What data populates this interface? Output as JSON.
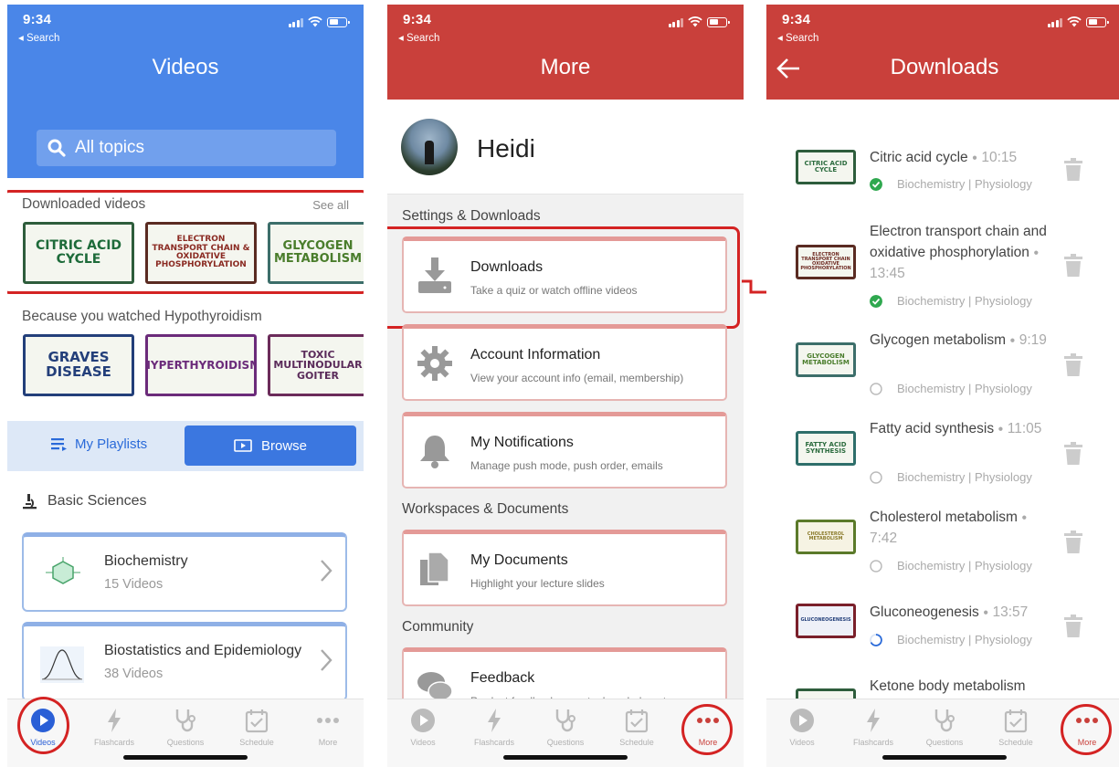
{
  "status": {
    "time": "9:34",
    "back_label": "◂ Search"
  },
  "tabs": [
    "Videos",
    "Flashcards",
    "Questions",
    "Schedule",
    "More"
  ],
  "videos_screen": {
    "title": "Videos",
    "search_placeholder": "All topics",
    "downloaded_heading": "Downloaded videos",
    "see_all": "See all",
    "downloaded_thumbs": [
      {
        "label": "CITRIC ACID CYCLE"
      },
      {
        "label": "ELECTRON TRANSPORT CHAIN & OXIDATIVE PHOSPHORYLATION"
      },
      {
        "label": "GLYCOGEN METABOLISM"
      }
    ],
    "because_heading": "Because you watched Hypothyroidism",
    "because_thumbs": [
      {
        "label": "GRAVES DISEASE"
      },
      {
        "label": "HYPERTHYROIDISM"
      },
      {
        "label": "TOXIC MULTINODULAR GOITER"
      }
    ],
    "my_playlists": "My Playlists",
    "browse": "Browse",
    "section_title": "Basic Sciences",
    "cards": [
      {
        "title": "Biochemistry",
        "subtitle": "15 Videos"
      },
      {
        "title": "Biostatistics and Epidemiology",
        "subtitle": "38 Videos"
      }
    ]
  },
  "more_screen": {
    "title": "More",
    "user_name": "Heidi",
    "group_settings": "Settings & Downloads",
    "group_workspaces": "Workspaces & Documents",
    "group_community": "Community",
    "items": [
      {
        "title": "Downloads",
        "subtitle": "Take a quiz or watch offline videos"
      },
      {
        "title": "Account Information",
        "subtitle": "View your account info (email, membership)"
      },
      {
        "title": "My Notifications",
        "subtitle": "Manage push mode, push order, emails"
      },
      {
        "title": "My Documents",
        "subtitle": "Highlight your lecture slides"
      },
      {
        "title": "Feedback",
        "subtitle": "Product feedback, report a bug, help out"
      }
    ]
  },
  "downloads_screen": {
    "title": "Downloads",
    "items": [
      {
        "title": "Citric acid cycle",
        "duration": "10:15",
        "tags": "Biochemistry | Physiology",
        "thumb": "CITRIC ACID CYCLE",
        "status": "complete"
      },
      {
        "title": "Electron transport chain and oxidative phosphorylation",
        "duration": "13:45",
        "tags": "Biochemistry | Physiology",
        "thumb": "ELECTRON TRANSPORT CHAIN OXIDATIVE PHOSPHORYLATION",
        "status": "complete"
      },
      {
        "title": "Glycogen metabolism",
        "duration": "9:19",
        "tags": "Biochemistry | Physiology",
        "thumb": "GLYCOGEN METABOLISM",
        "status": "pending"
      },
      {
        "title": "Fatty acid synthesis",
        "duration": "11:05",
        "tags": "Biochemistry | Physiology",
        "thumb": "FATTY ACID SYNTHESIS",
        "status": "pending"
      },
      {
        "title": "Cholesterol metabolism",
        "duration": "7:42",
        "tags": "Biochemistry | Physiology",
        "thumb": "CHOLESTEROL METABOLISM",
        "status": "pending"
      },
      {
        "title": "Gluconeogenesis",
        "duration": "13:57",
        "tags": "Biochemistry | Physiology",
        "thumb": "GLUCONEOGENESIS",
        "status": "downloading"
      },
      {
        "title": "Ketone body metabolism",
        "duration": "",
        "tags": "",
        "thumb": "",
        "status": ""
      }
    ]
  },
  "colors": {
    "videos_header": "#4a86e8",
    "more_header": "#c9403b",
    "highlight": "#d42323",
    "success": "#2fa84f",
    "active_tab_blue": "#2a5fd6"
  }
}
